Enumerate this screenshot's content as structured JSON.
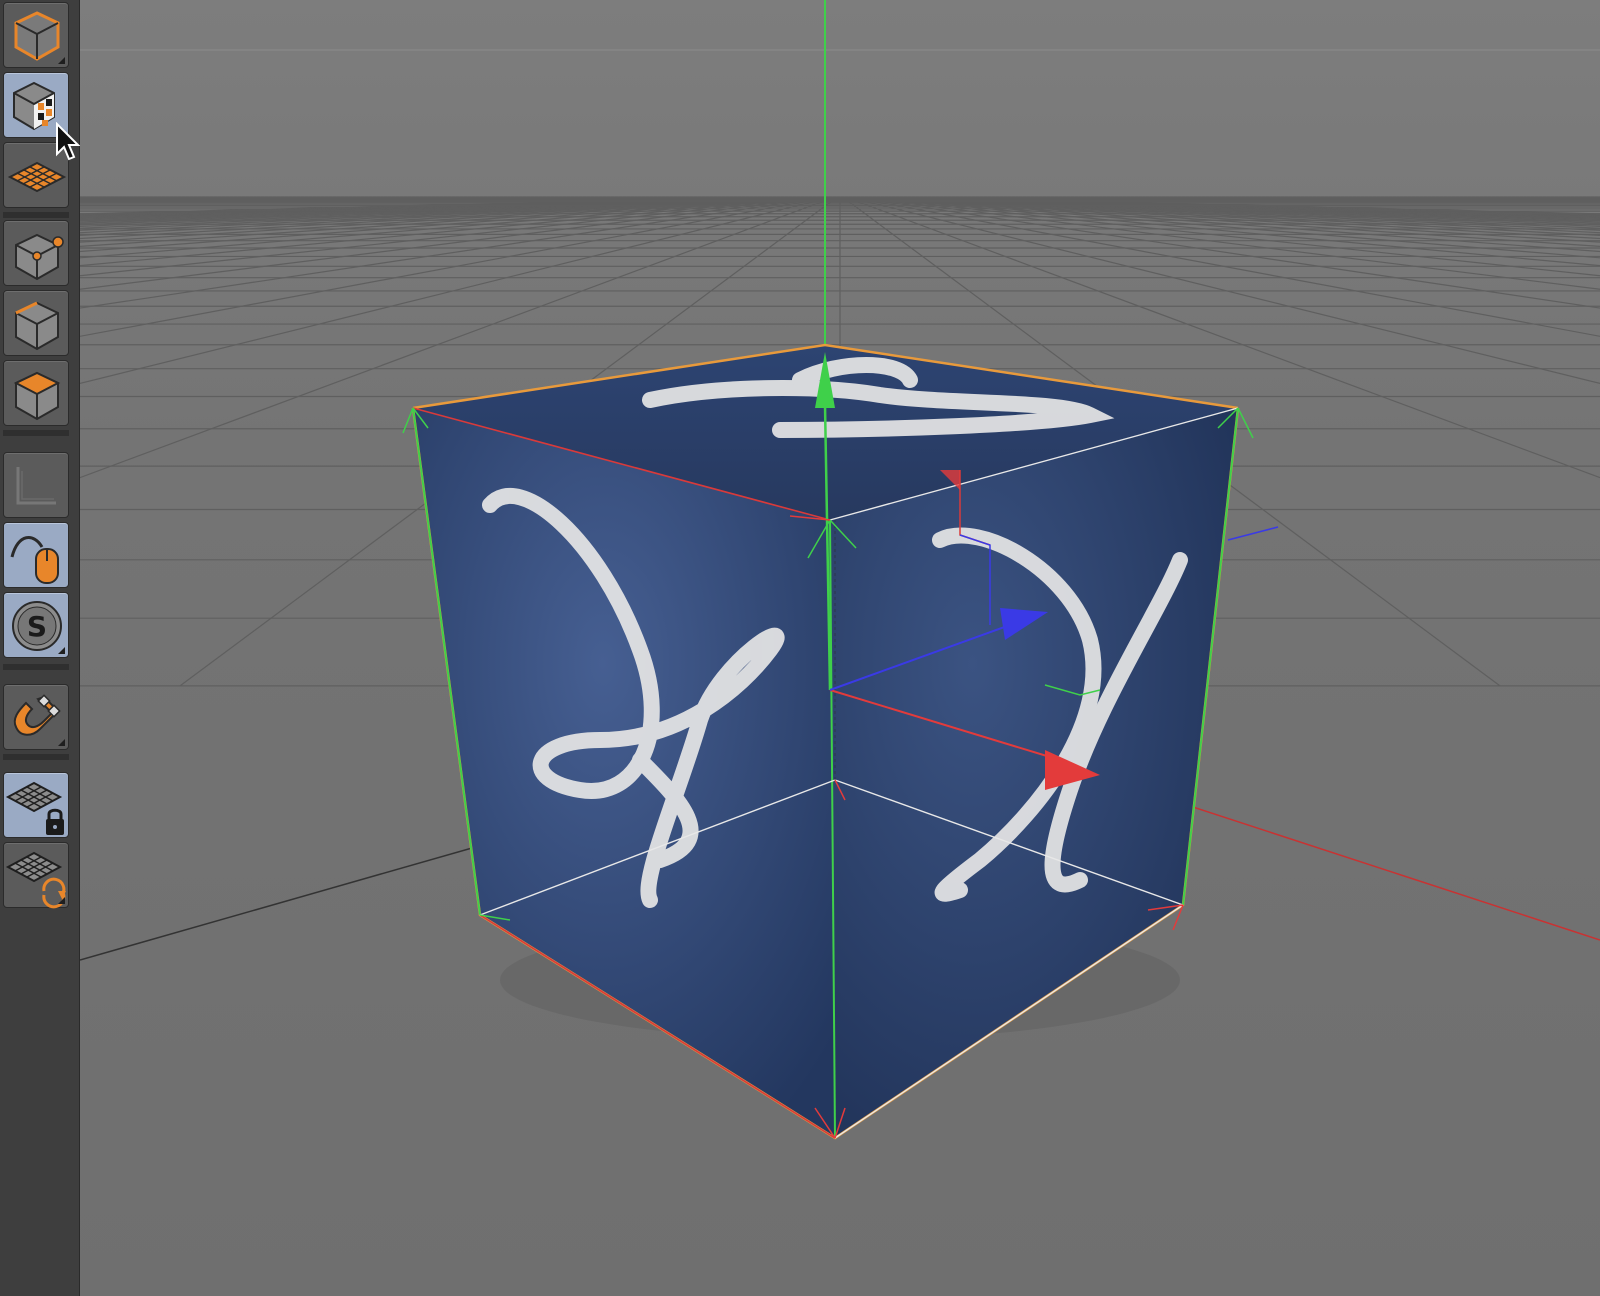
{
  "toolbar": {
    "tools": [
      {
        "name": "model-mode",
        "icon": "cube-outline-icon",
        "active": false,
        "has_submenu": true
      },
      {
        "name": "texture-mode",
        "icon": "cube-checker-icon",
        "active": true,
        "has_submenu": false
      },
      {
        "name": "workplane-mode",
        "icon": "grid-plane-icon",
        "active": false,
        "has_submenu": false
      },
      {
        "name": "points-mode",
        "icon": "cube-points-icon",
        "active": false,
        "has_submenu": false
      },
      {
        "name": "edges-mode",
        "icon": "cube-edges-icon",
        "active": false,
        "has_submenu": false
      },
      {
        "name": "polygons-mode",
        "icon": "cube-polygons-icon",
        "active": false,
        "has_submenu": false
      },
      {
        "name": "axis-mode",
        "icon": "axis-corner-icon",
        "active": false,
        "has_submenu": false
      },
      {
        "name": "tweak-mode",
        "icon": "mouse-curve-icon",
        "active": true,
        "has_submenu": false
      },
      {
        "name": "solo-mode",
        "icon": "solo-s-icon",
        "active": true,
        "has_submenu": true
      },
      {
        "name": "snapping",
        "icon": "magnet-icon",
        "active": false,
        "has_submenu": true
      },
      {
        "name": "lock-workplane",
        "icon": "grid-lock-icon",
        "active": true,
        "has_submenu": false
      },
      {
        "name": "align-workplane",
        "icon": "grid-rotate-icon",
        "active": false,
        "has_submenu": true
      }
    ]
  },
  "viewport": {
    "object": "cube",
    "colors": {
      "background": "#7b7b7b",
      "grid": "#5e5e5e",
      "cube_face": "#2b4170",
      "selection": "#e89a3c",
      "axis_x": "#e33b3b",
      "axis_y": "#3fd04a",
      "axis_z": "#3a3ae6"
    }
  }
}
